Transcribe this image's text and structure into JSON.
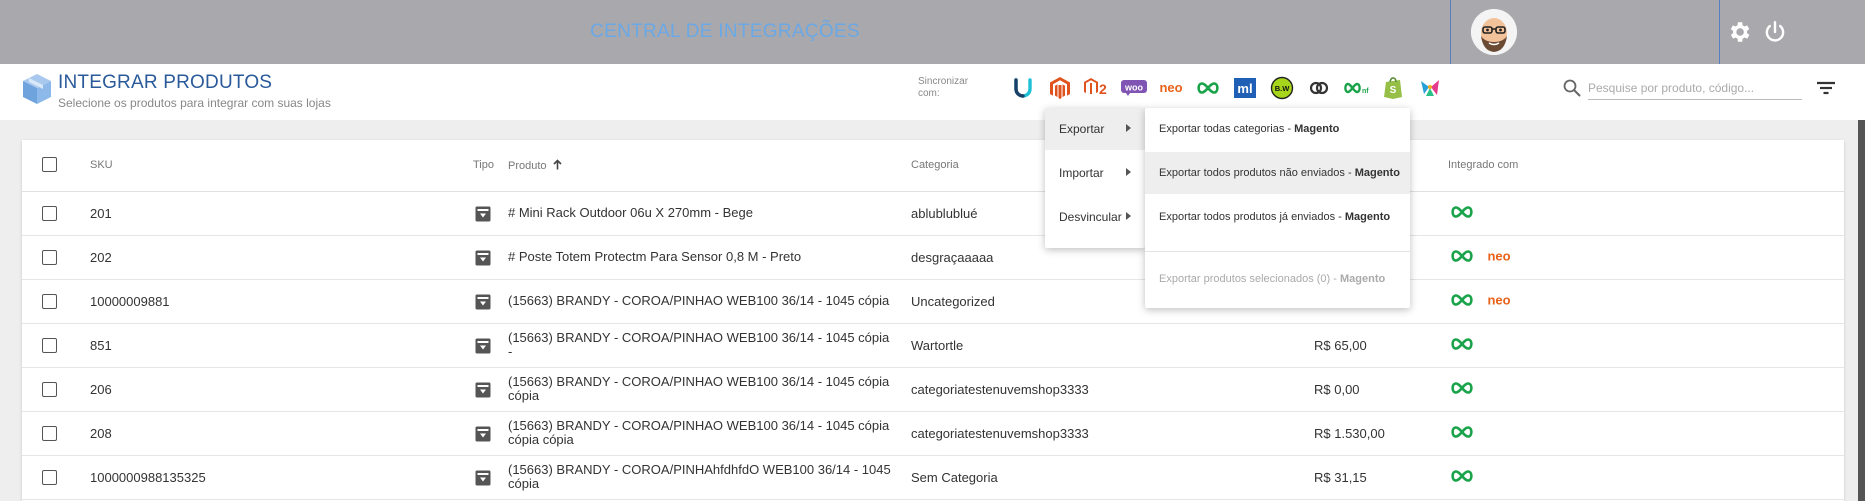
{
  "header": {
    "app_title": "CENTRAL DE INTEGRAÇÕES"
  },
  "subheader": {
    "title": "INTEGRAR PRODUTOS",
    "subtitle": "Selecione os produtos para integrar com suas lojas",
    "sync_label": "Sincronizar com:",
    "search_placeholder": "Pesquise por produto, código..."
  },
  "table": {
    "columns": {
      "sku": "SKU",
      "tipo": "Tipo",
      "produto": "Produto",
      "categoria": "Categoria",
      "integrado": "Integrado com"
    },
    "rows": [
      {
        "sku": "201",
        "produto": "# Mini Rack Outdoor 06u X 270mm - Bege",
        "produto2": "",
        "categoria": "ablublublué",
        "preco": "",
        "integrations": [
          "inf"
        ]
      },
      {
        "sku": "202",
        "produto": "# Poste Totem Protectm Para Sensor 0,8 M - Preto",
        "produto2": "",
        "categoria": "desgraçaaaaa",
        "preco": "",
        "integrations": [
          "inf",
          "neo"
        ]
      },
      {
        "sku": "10000009881",
        "produto": "(15663) BRANDY - COROA/PINHAO WEB100 36/14 - 1045 cópia",
        "produto2": "",
        "categoria": "Uncategorized",
        "preco": "",
        "integrations": [
          "inf",
          "neo"
        ]
      },
      {
        "sku": "851",
        "produto": "(15663) BRANDY - COROA/PINHAO WEB100 36/14 - 1045 cópia",
        "produto2": "-",
        "categoria": "Wartortle",
        "preco": "R$ 65,00",
        "integrations": [
          "inf"
        ]
      },
      {
        "sku": "206",
        "produto": "(15663) BRANDY - COROA/PINHAO WEB100 36/14 - 1045 cópia",
        "produto2": "cópia",
        "categoria": "categoriatestenuvemshop3333",
        "preco": "R$ 0,00",
        "integrations": [
          "inf"
        ]
      },
      {
        "sku": "208",
        "produto": "(15663) BRANDY - COROA/PINHAO WEB100 36/14 - 1045 cópia",
        "produto2": "cópia cópia",
        "categoria": "categoriatestenuvemshop3333",
        "preco": "R$ 1.530,00",
        "integrations": [
          "inf"
        ]
      },
      {
        "sku": "1000000988135325",
        "produto": "(15663) BRANDY - COROA/PINHAhfdhfdO WEB100 36/14 - 1045",
        "produto2": "cópia",
        "categoria": "Sem Categoria",
        "preco": "R$ 31,15",
        "integrations": [
          "inf"
        ]
      }
    ]
  },
  "menu": {
    "primary": [
      {
        "label": "Exportar"
      },
      {
        "label": "Importar"
      },
      {
        "label": "Desvincular"
      }
    ],
    "export": [
      {
        "text": "Exportar todas categorias - ",
        "store": "Magento"
      },
      {
        "text": "Exportar todos produtos não enviados - ",
        "store": "Magento"
      },
      {
        "text": "Exportar todos produtos já enviados - ",
        "store": "Magento"
      },
      {
        "text": "Exportar produtos selecionados (0) - ",
        "store": "Magento"
      }
    ]
  },
  "sync_stores": [
    {
      "name": "uello-icon",
      "label": ""
    },
    {
      "name": "magento-icon",
      "label": ""
    },
    {
      "name": "magento2-icon",
      "label": "2"
    },
    {
      "name": "woocommerce-icon",
      "label": "WOO"
    },
    {
      "name": "neo-icon",
      "label": "neo"
    },
    {
      "name": "infinity-icon",
      "label": ""
    },
    {
      "name": "mercadolivre-icon",
      "label": "ml"
    },
    {
      "name": "bw-icon",
      "label": "B.W"
    },
    {
      "name": "link-icon",
      "label": ""
    },
    {
      "name": "infinity-nf-icon",
      "label": ""
    },
    {
      "name": "shopify-icon",
      "label": ""
    },
    {
      "name": "bird-icon",
      "label": ""
    }
  ],
  "colors": {
    "topbar": "#a9a9ad",
    "title_blue": "#2a5a9a",
    "integration_green": "#1aa34a",
    "neo_orange": "#e8621a",
    "magento_orange": "#e0531f"
  }
}
